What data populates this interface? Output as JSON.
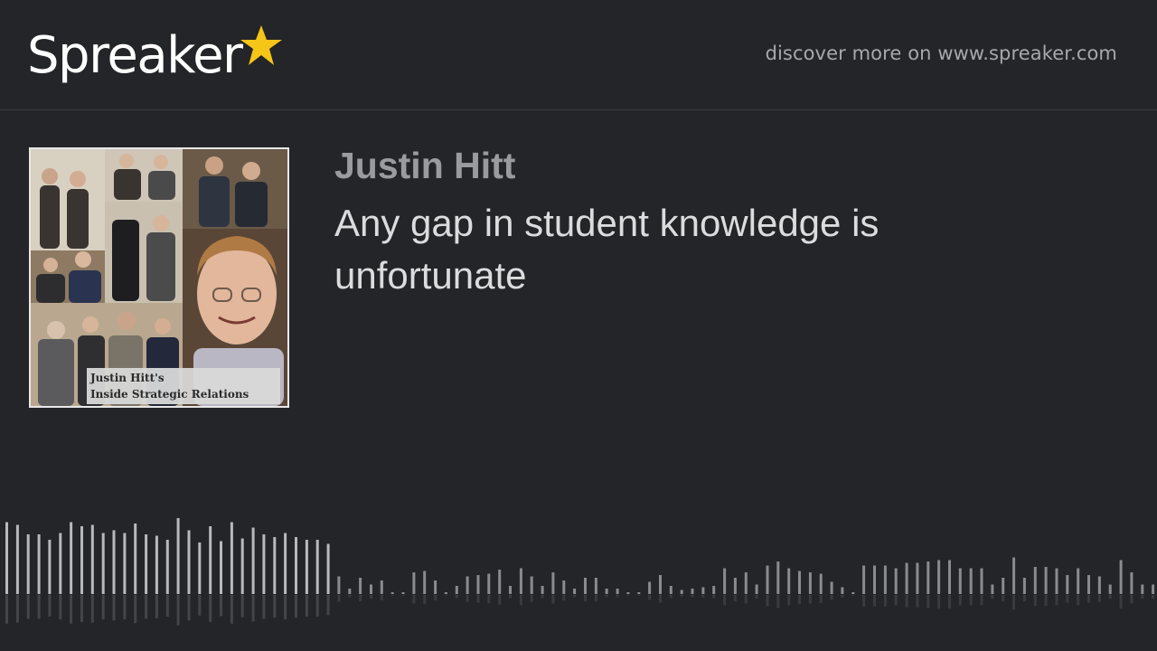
{
  "brand": {
    "name": "Spreaker"
  },
  "header": {
    "discover_text": "discover more on www.spreaker.com"
  },
  "episode": {
    "author": "Justin Hitt",
    "title": "Any gap in student knowledge is unfortunate"
  },
  "cover": {
    "caption_line1": "Justin Hitt's",
    "caption_line2": "Inside Strategic Relations"
  },
  "waveform": {
    "played_color": "#b8b9bc",
    "unplayed_color": "#8a8b8f",
    "progress": 0.29,
    "levels": [
      0.53,
      0.51,
      0.44,
      0.44,
      0.4,
      0.45,
      0.53,
      0.5,
      0.51,
      0.45,
      0.47,
      0.45,
      0.52,
      0.44,
      0.43,
      0.4,
      0.56,
      0.47,
      0.38,
      0.5,
      0.39,
      0.53,
      0.41,
      0.49,
      0.44,
      0.42,
      0.45,
      0.42,
      0.4,
      0.4,
      0.37,
      0.13,
      0.04,
      0.12,
      0.07,
      0.1,
      0.01,
      0.01,
      0.16,
      0.17,
      0.1,
      0.01,
      0.06,
      0.13,
      0.14,
      0.15,
      0.18,
      0.06,
      0.19,
      0.13,
      0.06,
      0.16,
      0.1,
      0.04,
      0.12,
      0.12,
      0.04,
      0.04,
      0.01,
      0.01,
      0.09,
      0.14,
      0.06,
      0.03,
      0.04,
      0.05,
      0.06,
      0.19,
      0.12,
      0.16,
      0.07,
      0.21,
      0.24,
      0.19,
      0.17,
      0.16,
      0.15,
      0.09,
      0.05,
      0.01,
      0.21,
      0.21,
      0.21,
      0.19,
      0.23,
      0.23,
      0.24,
      0.25,
      0.25,
      0.19,
      0.19,
      0.19,
      0.07,
      0.12,
      0.27,
      0.12,
      0.2,
      0.2,
      0.19,
      0.14,
      0.19,
      0.14,
      0.13,
      0.07,
      0.25,
      0.16,
      0.07,
      0.07
    ]
  }
}
